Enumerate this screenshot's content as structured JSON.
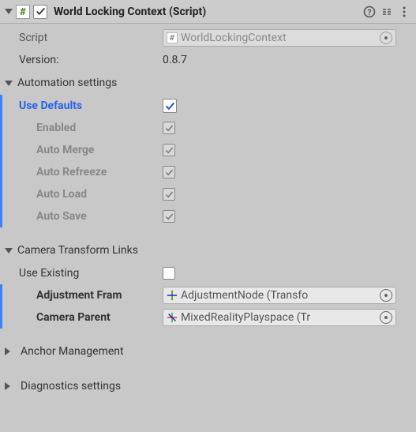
{
  "header": {
    "title": "World Locking Context (Script)",
    "scriptIconChar": "#",
    "enabled": true
  },
  "script": {
    "label": "Script",
    "iconChar": "#",
    "value": "WorldLockingContext"
  },
  "version": {
    "label": "Version:",
    "value": "0.8.7"
  },
  "automation": {
    "title": "Automation settings",
    "useDefaults": {
      "label": "Use Defaults",
      "checked": true
    },
    "items": [
      {
        "label": "Enabled",
        "checked": true
      },
      {
        "label": "Auto Merge",
        "checked": true
      },
      {
        "label": "Auto Refreeze",
        "checked": true
      },
      {
        "label": "Auto Load",
        "checked": true
      },
      {
        "label": "Auto Save",
        "checked": true
      }
    ]
  },
  "cameraLinks": {
    "title": "Camera Transform Links",
    "useExisting": {
      "label": "Use Existing",
      "checked": false
    },
    "adjustmentFrame": {
      "label": "Adjustment Fram",
      "value": "AdjustmentNode (Transfo"
    },
    "cameraParent": {
      "label": "Camera Parent",
      "value": "MixedRealityPlayspace (Tr"
    }
  },
  "anchorManagement": {
    "title": "Anchor Management"
  },
  "diagnostics": {
    "title": "Diagnostics settings"
  }
}
